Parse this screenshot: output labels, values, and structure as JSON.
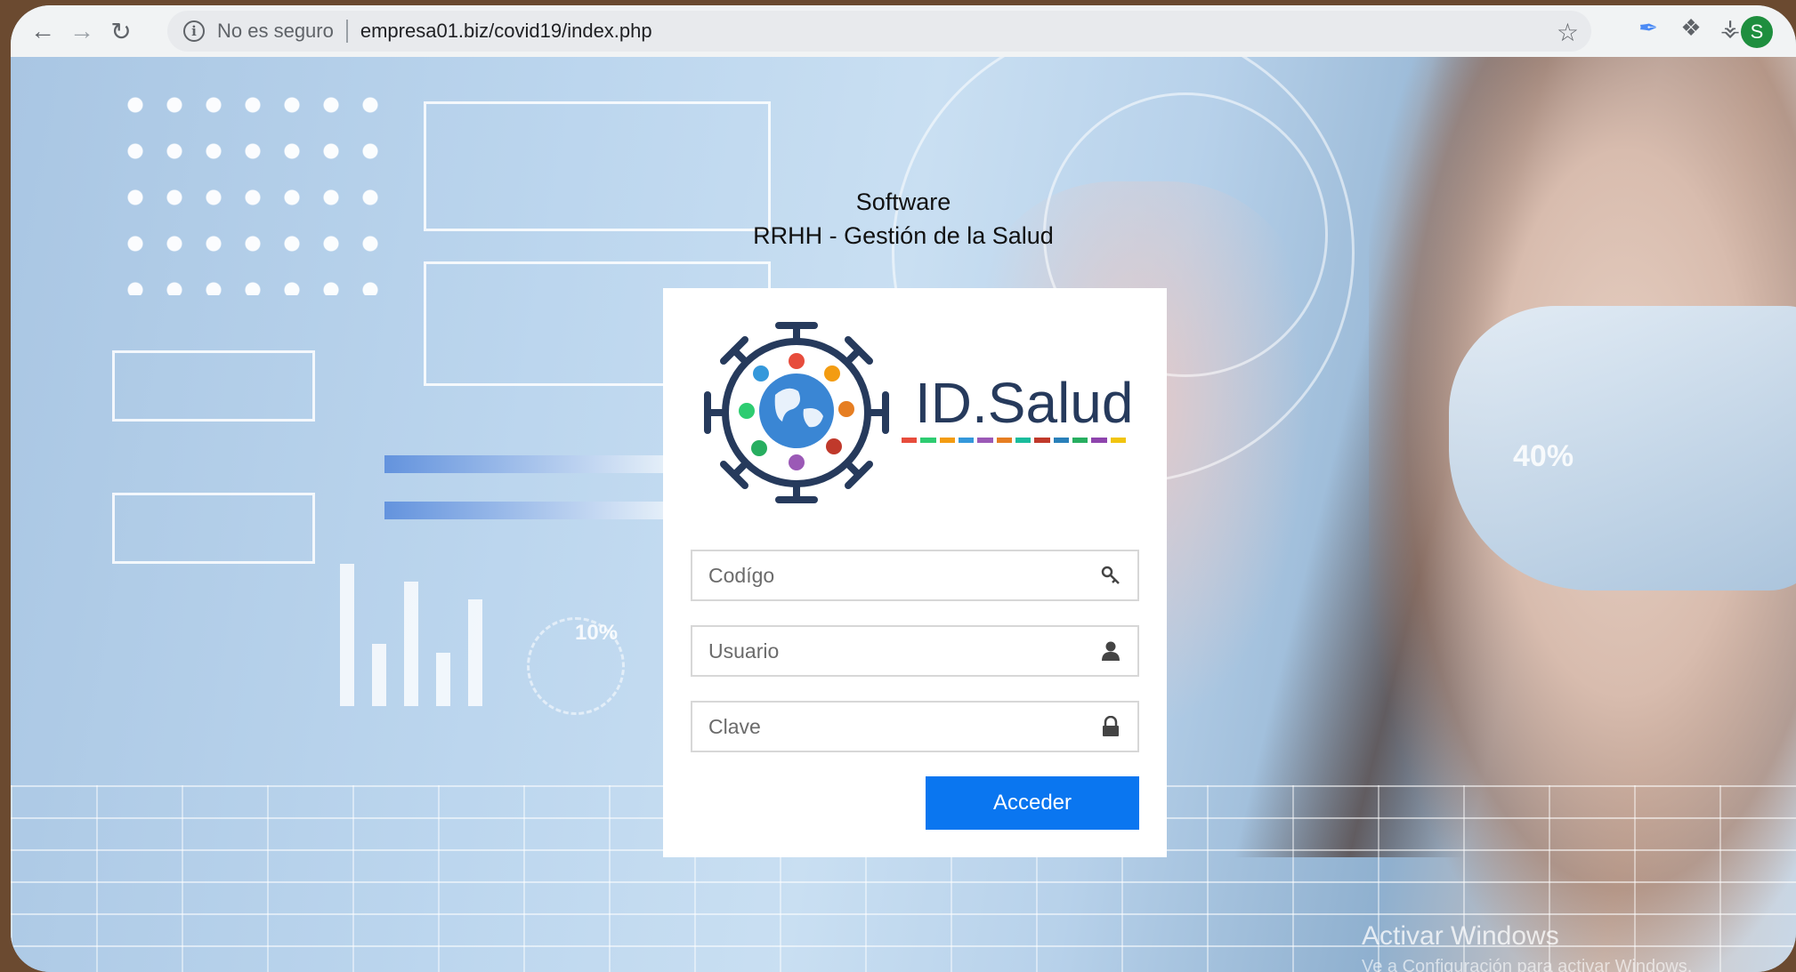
{
  "browser": {
    "security_label": "No es seguro",
    "url": "empresa01.biz/covid19/index.php",
    "avatar_initial": "S"
  },
  "page": {
    "heading_line1": "Software",
    "heading_line2": "RRHH - Gestión de la Salud",
    "brand_name": "ID.Salud",
    "brand_colors": [
      "#e74c3c",
      "#2ecc71",
      "#f39c12",
      "#3498db",
      "#9b59b6",
      "#e67e22",
      "#1abc9c",
      "#c0392b",
      "#2980b9",
      "#27ae60",
      "#8e44ad",
      "#f1c40f"
    ],
    "fields": {
      "codigo_placeholder": "Codígo",
      "usuario_placeholder": "Usuario",
      "clave_placeholder": "Clave"
    },
    "submit_label": "Acceder"
  },
  "background": {
    "deco_percent_1": "40%",
    "deco_percent_2": "10%"
  },
  "os": {
    "watermark_title": "Activar Windows",
    "watermark_sub": "Ve a Configuración para activar Windows."
  }
}
